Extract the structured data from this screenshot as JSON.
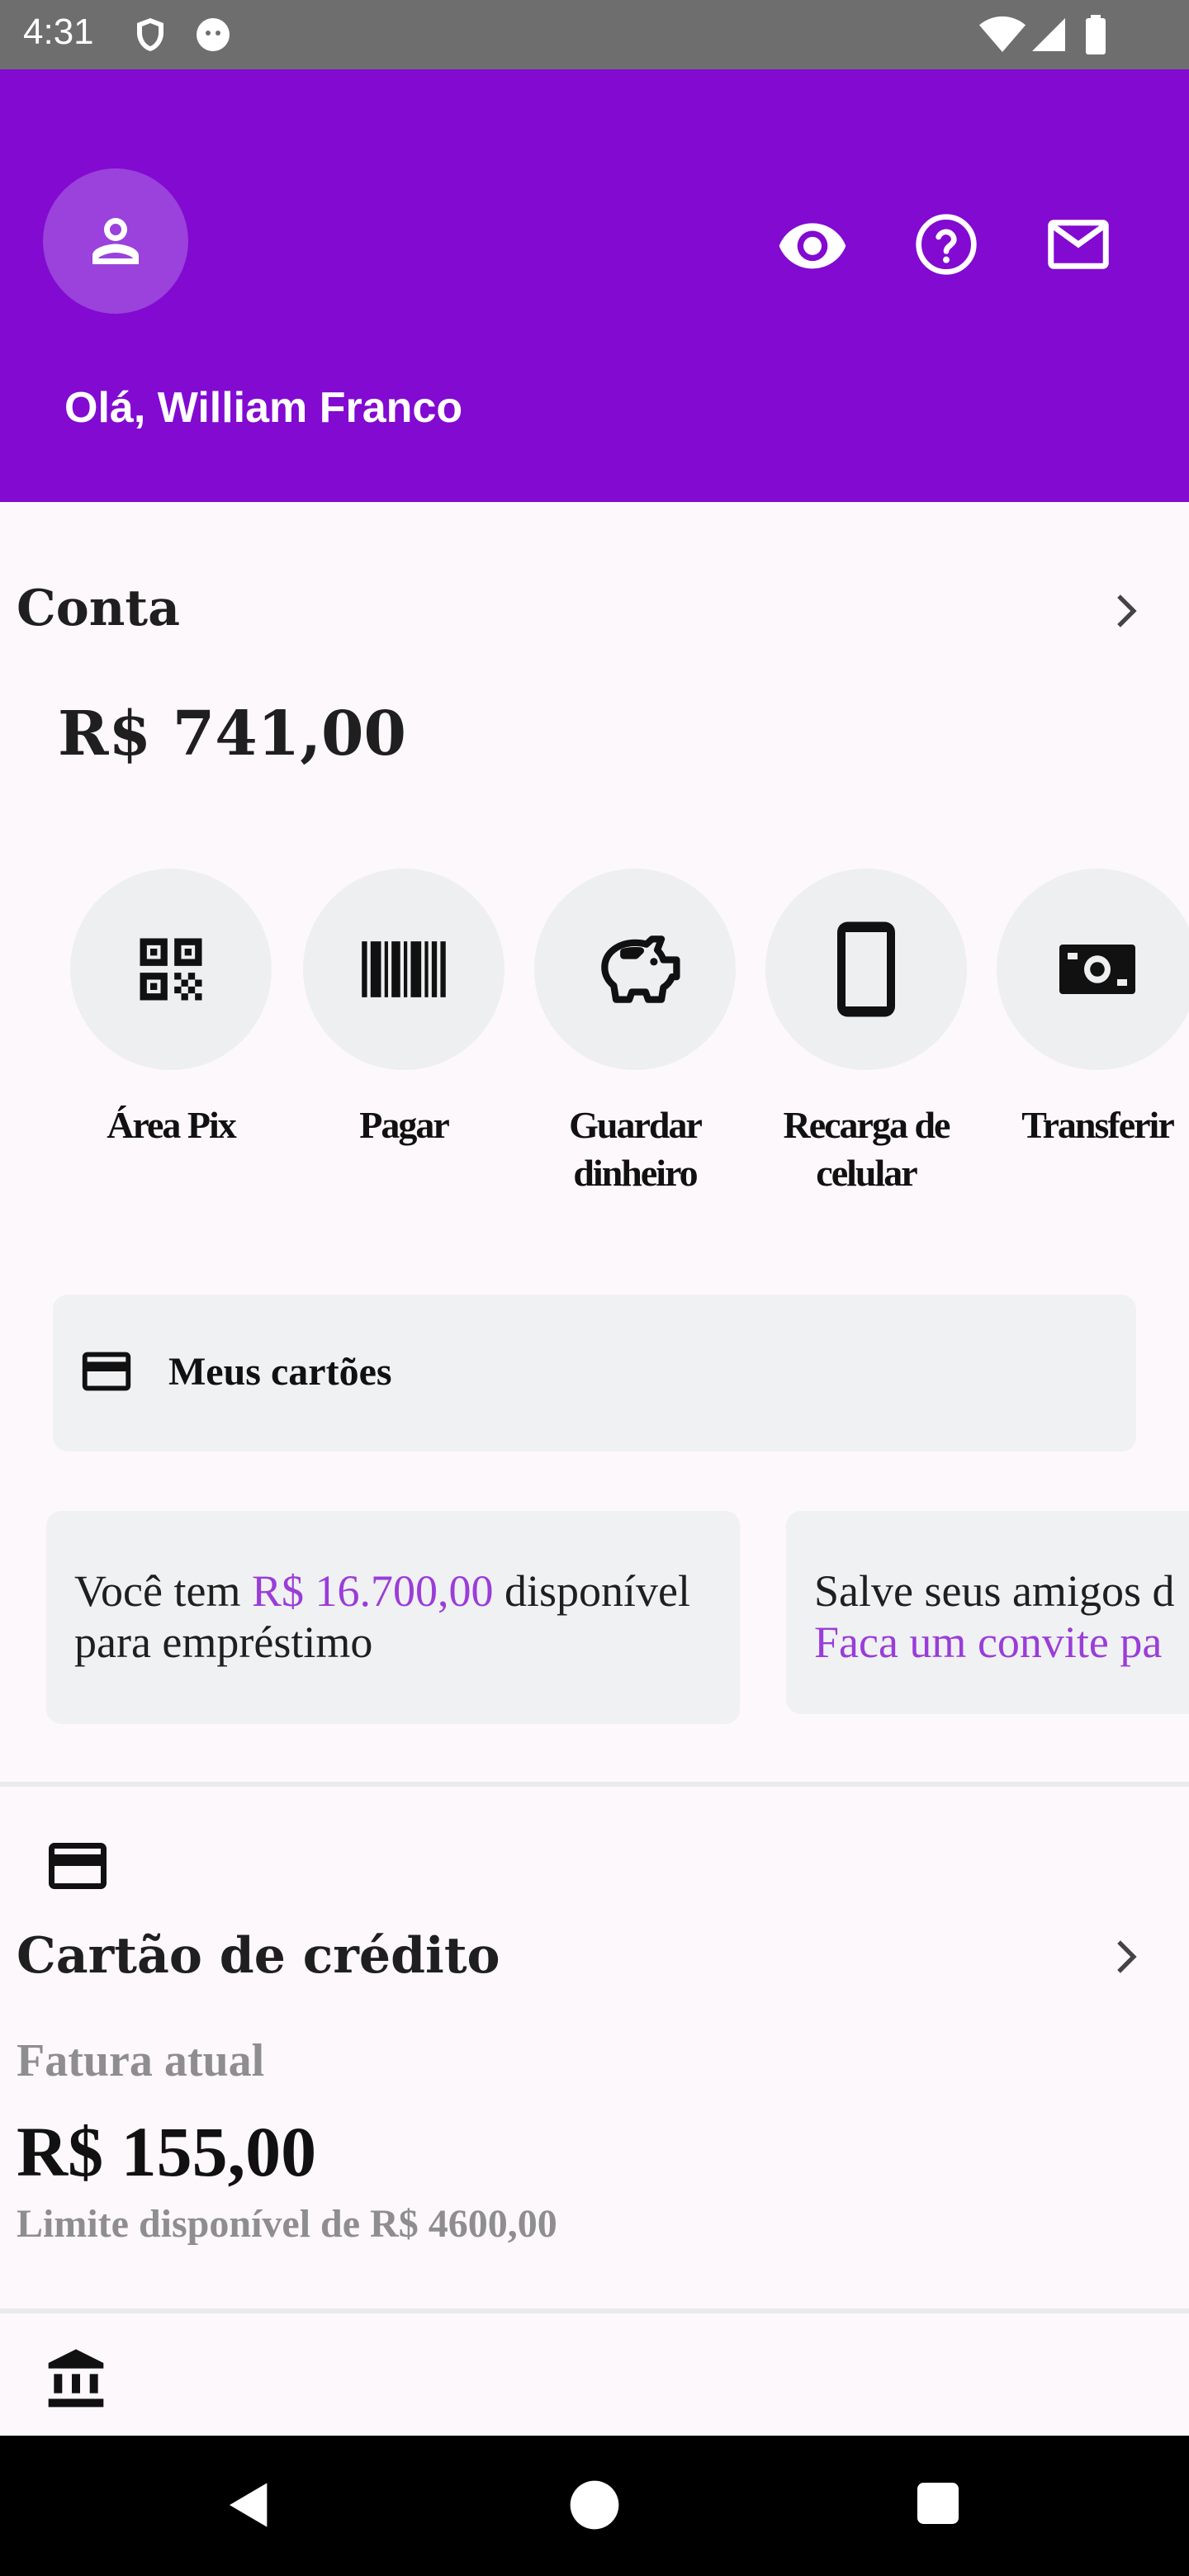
{
  "status_bar": {
    "time": "4:31"
  },
  "header": {
    "greeting": "Olá, William Franco",
    "background_color": "#820AD1",
    "icons": [
      "person-icon",
      "eye-icon",
      "help-icon",
      "mail-icon"
    ]
  },
  "account": {
    "title": "Conta",
    "balance": "R$ 741,00"
  },
  "actions": [
    {
      "label": "Área Pix",
      "icon": "qr-code-icon"
    },
    {
      "label": "Pagar",
      "icon": "barcode-icon"
    },
    {
      "label": "Guardar dinheiro",
      "icon": "piggy-bank-icon"
    },
    {
      "label": "Recarga de celular",
      "icon": "phone-icon"
    },
    {
      "label": "Transferir",
      "icon": "cash-icon"
    }
  ],
  "my_cards": {
    "label": "Meus cartões"
  },
  "promos": [
    {
      "prefix": "Você tem ",
      "highlight": "R$ 16.700,00",
      "suffix": " disponível",
      "line2": "para empréstimo"
    },
    {
      "line1": "Salve seus amigos d",
      "line2": "Faca um convite pa"
    }
  ],
  "credit_card": {
    "title": "Cartão de crédito",
    "current_bill_label": "Fatura atual",
    "current_bill": "R$ 155,00",
    "limit_text": "Limite disponível de R$ 4600,00"
  }
}
